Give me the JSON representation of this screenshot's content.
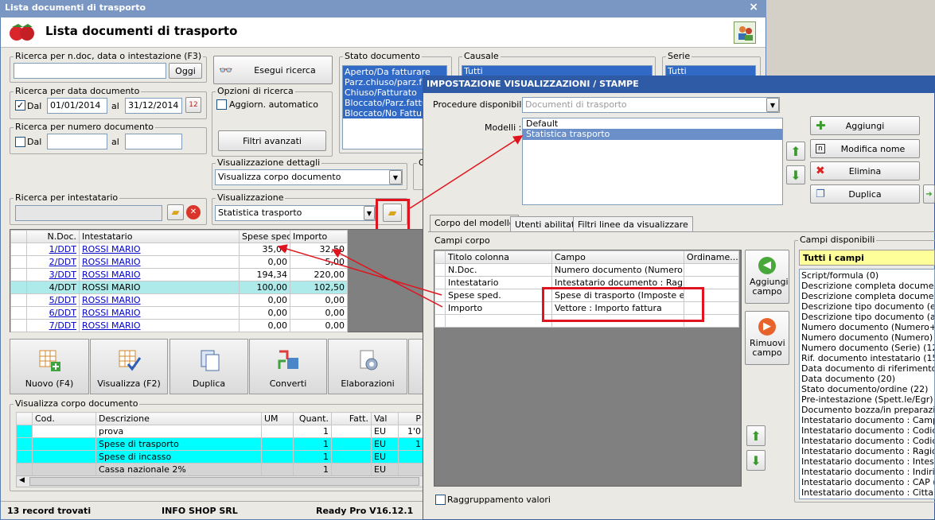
{
  "main": {
    "title": "Lista documenti di trasporto",
    "heading": "Lista documenti di trasporto",
    "close": "×",
    "search_ndoc": {
      "label": "Ricerca per n.doc, data o intestazione (F3)",
      "value": "",
      "button": "Oggi"
    },
    "search_btn": "Esegui ricerca",
    "date": {
      "label": "Ricerca per data documento",
      "check": "Dal",
      "from": "01/01/2014",
      "to_label": "al",
      "to": "31/12/2014"
    },
    "number": {
      "label": "Ricerca per numero documento",
      "check": "Dal",
      "to_label": "al"
    },
    "options": {
      "label": "Opzioni di ricerca",
      "check": "Aggiorn. automatico",
      "filters": "Filtri avanzati"
    },
    "stato": {
      "label": "Stato documento",
      "items": [
        "Aperto/Da fatturare",
        "Parz.chiuso/parz.fatt",
        "Chiuso/Fatturato",
        "Bloccato/Parz.fatturato",
        "Bloccato/No Fattura"
      ]
    },
    "causale": {
      "label": "Causale",
      "value": "Tutti"
    },
    "serie": {
      "label": "Serie",
      "value": "Tutti"
    },
    "vis_dettagli": {
      "label": "Visualizzazione dettagli",
      "value": "Visualizza corpo documento"
    },
    "g_label": "G",
    "intestatario": {
      "label": "Ricerca per intestatario"
    },
    "vis": {
      "label": "Visualizzazione",
      "value": "Statistica trasporto"
    },
    "grid": {
      "headers": [
        "N.Doc.",
        "Intestatario",
        "Spese sped.",
        "Importo"
      ],
      "rows": [
        [
          "1/DDT",
          "ROSSI MARIO",
          "35,00",
          "32,50"
        ],
        [
          "2/DDT",
          "ROSSI MARIO",
          "0,00",
          "5,00"
        ],
        [
          "3/DDT",
          "ROSSI MARIO",
          "194,34",
          "220,00"
        ],
        [
          "4/DDT",
          "ROSSI MARIO",
          "100,00",
          "102,50"
        ],
        [
          "5/DDT",
          "ROSSI MARIO",
          "0,00",
          "0,00"
        ],
        [
          "6/DDT",
          "ROSSI MARIO",
          "0,00",
          "0,00"
        ],
        [
          "7/DDT",
          "ROSSI MARIO",
          "0,00",
          "0,00"
        ]
      ]
    },
    "actions": [
      "Nuovo (F4)",
      "Visualizza (F2)",
      "Duplica",
      "Converti",
      "Elaborazioni"
    ],
    "body": {
      "label": "Visualizza corpo documento",
      "headers": [
        "Cod.",
        "Descrizione",
        "UM",
        "Quant.",
        "Fatt.",
        "Val",
        "P"
      ],
      "rows": [
        [
          "",
          "prova",
          "",
          "1",
          "",
          "EU",
          "1'0"
        ],
        [
          "",
          "Spese di trasporto",
          "",
          "1",
          "",
          "EU",
          "1"
        ],
        [
          "",
          "Spese di incasso",
          "",
          "1",
          "",
          "EU",
          ""
        ],
        [
          "",
          "Cassa nazionale 2%",
          "",
          "1",
          "",
          "EU",
          ""
        ]
      ]
    },
    "status": {
      "records": "13 record trovati",
      "company": "INFO SHOP SRL",
      "version": "Ready Pro V16.12.1"
    }
  },
  "dialog": {
    "title": "IMPOSTAZIONE VISUALIZZAZIONI / STAMPE",
    "proc_label": "Procedure disponibili :",
    "proc_value": "Documenti di trasporto",
    "models_label": "Modelli :",
    "models": [
      "Default",
      "Statistica trasporto"
    ],
    "buttons": [
      "Aggiungi",
      "Modifica nome",
      "Elimina",
      "Duplica"
    ],
    "tabs": [
      "Corpo del modello",
      "Utenti abilitati",
      "Filtri linee da visualizzare"
    ],
    "campi_corpo": "Campi corpo",
    "grid_headers": [
      "Titolo colonna",
      "Campo",
      "Ordiname..."
    ],
    "grid_rows": [
      [
        "N.Doc.",
        "Numero documento (Numero+...",
        ""
      ],
      [
        "Intestatario",
        "Intestatario documento : Ragi...",
        ""
      ],
      [
        "Spese sped.",
        "Spese di trasporto (Imposte es...",
        ""
      ],
      [
        "Importo",
        "Vettore : Importo fattura",
        ""
      ]
    ],
    "add": "Aggiungi campo",
    "remove": "Rimuovi campo",
    "group": "Raggruppamento valori",
    "disp_label": "Campi disponibili",
    "disp_header": "Tutti i campi",
    "disp_items": [
      "Script/formula (0)",
      "Descrizione completa documento (T",
      "Descrizione completa documento (T",
      "Descrizione tipo documento (estesa",
      "Descrizione tipo documento (abbre",
      "Numero documento (Numero+Serie",
      "Numero documento (Numero) (11)",
      "Numero documento (Serie) (12)",
      "Rif. documento intestatario (15)",
      "Data documento di riferimento inte",
      "Data documento (20)",
      "Stato documento/ordine (22)",
      "Pre-intestazione (Spett.le/Egr) (23",
      "Documento bozza/in preparazione",
      "Intestatario documento : Campo pe",
      "Intestatario documento : Codice alt",
      "Intestatario documento : Codice (2",
      "Intestatario documento : Ragione s",
      "Intestatario documento : Intestazio",
      "Intestatario documento : Indirizzo (",
      "Intestatario documento : CAP (34)",
      "Intestatario documento : Citta' (36"
    ]
  }
}
